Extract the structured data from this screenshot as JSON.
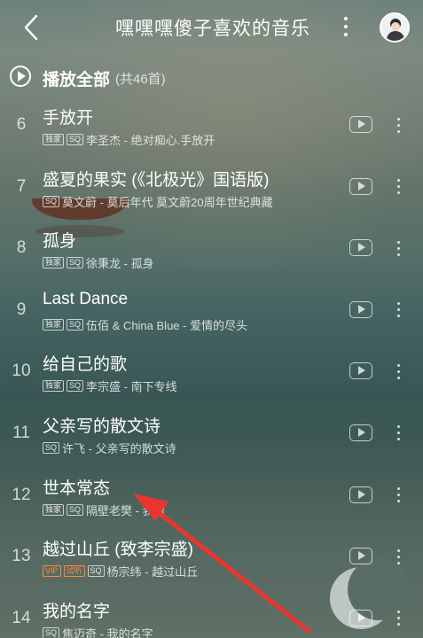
{
  "header": {
    "title": "嘿嘿嘿傻子喜欢的音乐",
    "back_icon": "back-chevron-icon",
    "more_icon": "more-vertical-icon"
  },
  "playall": {
    "label": "播放全部",
    "count": "(共46首)",
    "icon": "play-circle-icon"
  },
  "songs": [
    {
      "index": "6",
      "title": "手放开",
      "tags": [
        "独家",
        "SQ"
      ],
      "artist_album": "李圣杰 - 绝对痴心.手放开"
    },
    {
      "index": "7",
      "title": "盛夏的果实 (《北极光》国语版)",
      "tags": [
        "SQ"
      ],
      "artist_album": "莫文蔚 - 莫后年代 莫文蔚20周年世纪典藏"
    },
    {
      "index": "8",
      "title": "孤身",
      "tags": [
        "独家",
        "SQ"
      ],
      "artist_album": "徐秉龙 - 孤身"
    },
    {
      "index": "9",
      "title": "Last Dance",
      "tags": [
        "独家",
        "SQ"
      ],
      "artist_album": "伍佰 & China Blue - 爱情的尽头"
    },
    {
      "index": "10",
      "title": "给自己的歌",
      "tags": [
        "独家",
        "SQ"
      ],
      "artist_album": "李宗盛 - 南下专线"
    },
    {
      "index": "11",
      "title": "父亲写的散文诗",
      "tags": [
        "SQ"
      ],
      "artist_album": "许飞 - 父亲写的散文诗"
    },
    {
      "index": "12",
      "title": "世本常态",
      "tags": [
        "独家",
        "SQ"
      ],
      "artist_album": "隔壁老樊 - 我曾"
    },
    {
      "index": "13",
      "title": "越过山丘 (致李宗盛)",
      "tags": [
        "VIP",
        "试听",
        "SQ"
      ],
      "artist_album": "杨宗纬 - 越过山丘"
    },
    {
      "index": "14",
      "title": "我的名字",
      "tags": [
        "SQ"
      ],
      "artist_album": "焦迈奇 - 我的名字"
    }
  ],
  "colors": {
    "accent_orange": "#ff8a3c",
    "arrow_red": "#e8362f"
  }
}
